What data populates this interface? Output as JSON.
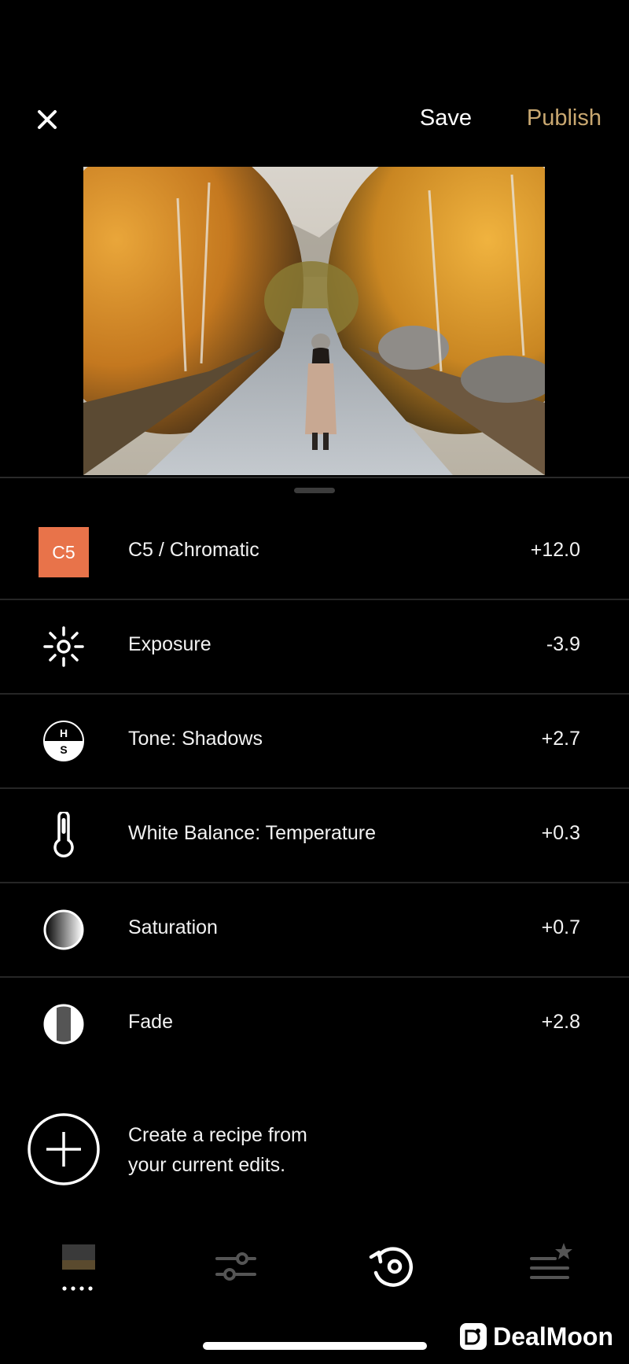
{
  "topbar": {
    "save_label": "Save",
    "publish_label": "Publish",
    "publish_color": "#C9A871"
  },
  "edits": [
    {
      "icon": "preset-badge",
      "badge": "C5",
      "badge_color": "#E8734A",
      "label": "C5 / Chromatic",
      "value": "+12.0"
    },
    {
      "icon": "exposure-sun-icon",
      "label": "Exposure",
      "value": "-3.9"
    },
    {
      "icon": "tone-hs-icon",
      "label": "Tone: Shadows",
      "value": "+2.7"
    },
    {
      "icon": "thermometer-icon",
      "label": "White Balance: Temperature",
      "value": "+0.3"
    },
    {
      "icon": "saturation-icon",
      "label": "Saturation",
      "value": "+0.7"
    },
    {
      "icon": "fade-icon",
      "label": "Fade",
      "value": "+2.8"
    }
  ],
  "recipe": {
    "line1": "Create a recipe from",
    "line2": "your current edits."
  },
  "nav": {
    "items": [
      "presets-icon",
      "sliders-icon",
      "history-icon",
      "recipes-icon"
    ],
    "active": "history-icon"
  },
  "watermark": {
    "text": "DealMoon"
  }
}
